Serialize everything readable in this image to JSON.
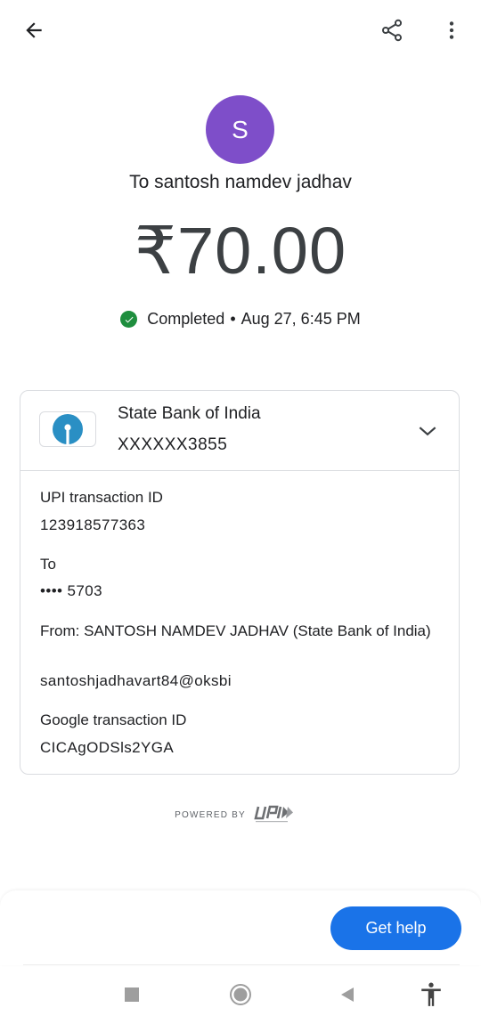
{
  "header": {
    "back_icon": "arrow-back-icon",
    "share_icon": "share-icon",
    "more_icon": "more-vert-icon"
  },
  "payee": {
    "avatar_letter": "S",
    "avatar_color": "#7e4ec9",
    "to_text": "To santosh namdev jadhav"
  },
  "amount": "₹70.00",
  "status": {
    "icon": "check-circle-icon",
    "color": "#1e8e3e",
    "label": "Completed",
    "separator": "•",
    "datetime": "Aug 27, 6:45 PM"
  },
  "bank": {
    "name": "State Bank of India",
    "account": "XXXXXX3855",
    "logo_icon": "sbi-logo-icon",
    "expand_icon": "chevron-down-icon"
  },
  "details": {
    "upi_id_label": "UPI transaction ID",
    "upi_id_value": "123918577363",
    "to_label": "To",
    "to_value": "•••• 5703",
    "from_label": "From: SANTOSH NAMDEV JADHAV (State Bank of India)",
    "from_value": "santoshjadhavart84@oksbi",
    "google_id_label": "Google transaction ID",
    "google_id_value": "CICAgODSls2YGA"
  },
  "footer": {
    "powered_by": "POWERED BY",
    "upi_logo_icon": "upi-logo-icon",
    "get_help_label": "Get help",
    "accent": "#1a73e8"
  },
  "system_nav": {
    "recents_icon": "square-icon",
    "home_icon": "circle-icon",
    "back_icon": "triangle-back-icon",
    "accessibility_icon": "accessibility-icon"
  }
}
